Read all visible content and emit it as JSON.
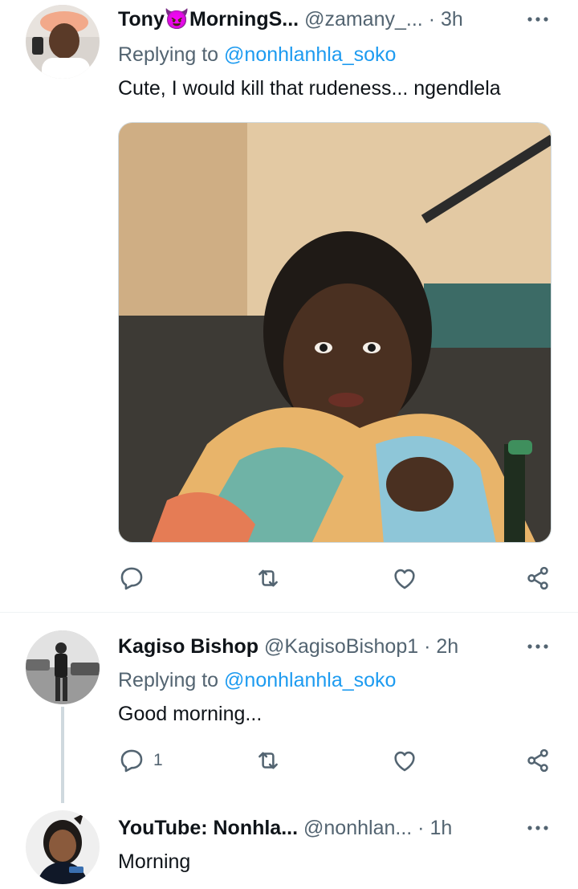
{
  "tweets": [
    {
      "name": "Tony",
      "name_emoji": "😈",
      "name_rest": "MorningS...",
      "handle": "@zamany_...",
      "dot": "·",
      "time": "3h",
      "replying_prefix": "Replying to",
      "replying_to": "@nonhlanhla_soko",
      "text": "Cute, I would kill that rudeness... ngendlela",
      "reply_count": ""
    },
    {
      "name": "Kagiso Bishop",
      "handle": "@KagisoBishop1",
      "dot": "·",
      "time": "2h",
      "replying_prefix": "Replying to",
      "replying_to": "@nonhlanhla_soko",
      "text": "Good morning...",
      "reply_count": "1"
    },
    {
      "name": "YouTube: Nonhla...",
      "handle": "@nonhlan...",
      "dot": "·",
      "time": "1h",
      "text": "Morning"
    }
  ],
  "icons": {
    "reply": "reply-icon",
    "retweet": "retweet-icon",
    "like": "heart-icon",
    "share": "share-icon",
    "more": "more-icon"
  },
  "colors": {
    "link": "#1d9bf0",
    "secondary_text": "#536471",
    "primary_text": "#0f1419",
    "icon": "#536471"
  }
}
